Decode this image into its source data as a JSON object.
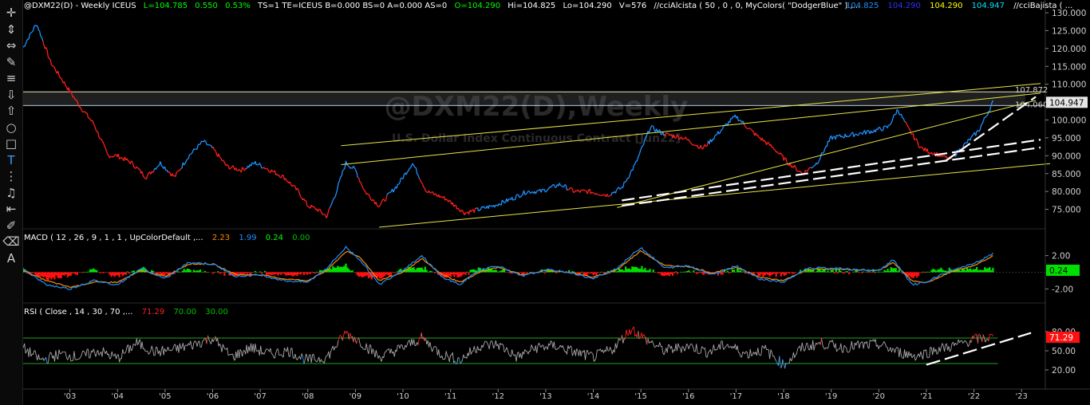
{
  "header": {
    "symbol": "@DXM22(D) - Weekly  ICEUS",
    "last": "L=104.785",
    "change": "0.550",
    "pct": "0.53%",
    "ts": "TS=1  TE=ICEUS  B=0.000  BS=0  A=0.000  AS=0",
    "open": "O=104.290",
    "high": "Hi=104.825",
    "low": "Lo=104.290",
    "vol": "V=576",
    "study": "//cciAlcista ( 50 , 0 , 0, MyColors( \"DodgerBlue\" ) ,...",
    "v1": "104.825",
    "v2": "104.290",
    "v3": "104.290",
    "v4": "104.947",
    "study2": "//cciBajista ( ..."
  },
  "watermark": {
    "title": "@DXM22(D),Weekly",
    "subtitle": "U.S. Dollar Index Continuous Contract [Jun22]"
  },
  "price_labels": {
    "upper": "107.872",
    "lower": "104.060",
    "last": "104.947"
  },
  "macd": {
    "label": "MACD ( 12 , 26 , 9 , 1 , 1 , UpColorDefault ,...",
    "v1": "2.23",
    "v2": "1.99",
    "v3": "0.24",
    "v4": "0.00",
    "last": "0.24"
  },
  "rsi": {
    "label": "RSI ( Close , 14 , 30 , 70 ,...",
    "v1": "71.29",
    "v2": "70.00",
    "v3": "30.00",
    "last": "71.29"
  },
  "toolbar": [
    {
      "name": "crosshair-tool",
      "icon": "crosshair-icon",
      "glyph": "✛"
    },
    {
      "name": "vertical-line-tool",
      "icon": "vertical-arrows-icon",
      "glyph": "⇕"
    },
    {
      "name": "horizontal-line-tool",
      "icon": "horizontal-arrows-icon",
      "glyph": "⇔"
    },
    {
      "name": "trendline-tool",
      "icon": "pencil-icon",
      "glyph": "✎"
    },
    {
      "name": "parallel-lines-tool",
      "icon": "lines-icon",
      "glyph": "≡"
    },
    {
      "name": "arrow-down-tool",
      "icon": "arrow-down-icon",
      "glyph": "⇩"
    },
    {
      "name": "arrow-up-tool",
      "icon": "arrow-up-icon",
      "glyph": "⇧"
    },
    {
      "name": "ellipse-tool",
      "icon": "circle-icon",
      "glyph": "○"
    },
    {
      "name": "rectangle-tool",
      "icon": "square-icon",
      "glyph": "□"
    },
    {
      "name": "text-tool",
      "icon": "text-icon",
      "glyph": "T"
    },
    {
      "name": "fibonacci-tool",
      "icon": "fib-icon",
      "glyph": "⋮"
    },
    {
      "name": "alert-tool",
      "icon": "bell-icon",
      "glyph": "♫"
    },
    {
      "name": "measure-tool",
      "icon": "measure-icon",
      "glyph": "⇤"
    },
    {
      "name": "paint-tool",
      "icon": "brush-icon",
      "glyph": "✐"
    },
    {
      "name": "eraser-tool",
      "icon": "eraser-icon",
      "glyph": "⌫"
    },
    {
      "name": "annotate-tool",
      "icon": "annotate-icon",
      "glyph": "A"
    }
  ],
  "chart_data": [
    {
      "type": "line",
      "ylim": [
        70,
        130
      ],
      "yticks": [
        "130.000",
        "125.000",
        "120.000",
        "115.000",
        "110.000",
        "105.000",
        "100.000",
        "95.000",
        "90.000",
        "85.000",
        "80.000",
        "75.000"
      ],
      "xticks": [
        "'03",
        "'04",
        "'05",
        "'06",
        "'07",
        "'08",
        "'09",
        "'10",
        "'11",
        "'12",
        "'13",
        "'14",
        "'15",
        "'16",
        "'17",
        "'18",
        "'19",
        "'20",
        "'21",
        "'22",
        "'23"
      ],
      "x": [
        2002.0,
        2002.3,
        2002.6,
        2002.9,
        2003.2,
        2003.5,
        2003.8,
        2004.0,
        2004.3,
        2004.6,
        2004.9,
        2005.2,
        2005.5,
        2005.8,
        2006.0,
        2006.3,
        2006.6,
        2006.9,
        2007.2,
        2007.5,
        2007.8,
        2008.0,
        2008.2,
        2008.4,
        2008.6,
        2008.8,
        2009.0,
        2009.2,
        2009.5,
        2009.9,
        2010.2,
        2010.5,
        2010.9,
        2011.3,
        2011.6,
        2011.9,
        2012.3,
        2012.6,
        2012.9,
        2013.3,
        2013.6,
        2013.9,
        2014.3,
        2014.6,
        2014.9,
        2015.2,
        2015.5,
        2015.9,
        2016.3,
        2016.6,
        2016.9,
        2017.0,
        2017.4,
        2017.8,
        2018.1,
        2018.4,
        2018.7,
        2019.0,
        2019.5,
        2019.9,
        2020.2,
        2020.4,
        2020.6,
        2020.9,
        2021.3,
        2021.5,
        2021.8,
        2022.1,
        2022.4
      ],
      "values": [
        120,
        127,
        116,
        110,
        104,
        99,
        90,
        90,
        88,
        84,
        88,
        84,
        90,
        94,
        92,
        87,
        86,
        88,
        86,
        84,
        80,
        76,
        75,
        73,
        80,
        88,
        86,
        80,
        76,
        82,
        88,
        80,
        78,
        74,
        75,
        76,
        78,
        80,
        80,
        82,
        80,
        80,
        79,
        81,
        88,
        98,
        96,
        95,
        92,
        96,
        100,
        101,
        96,
        92,
        88,
        85,
        88,
        95,
        96,
        97,
        98,
        103,
        98,
        92,
        90,
        89,
        93,
        97,
        104.947
      ],
      "colors": {
        "up": "#1e90ff",
        "down": "#ff1e1e",
        "channel": "#e6e64a",
        "support": "#ffffff",
        "resistance_zone": "#5a5a5a"
      },
      "levels": [
        107.872,
        104.06
      ]
    },
    {
      "type": "line",
      "title": "MACD",
      "ylim": [
        -3.5,
        3.5
      ],
      "yticks": [
        "2.00",
        "0.24",
        "-2.00"
      ],
      "series": [
        {
          "name": "MACD",
          "color": "#1e90ff"
        },
        {
          "name": "Signal",
          "color": "#ff8c00"
        }
      ],
      "x": [
        2002.0,
        2002.5,
        2003.0,
        2003.5,
        2004.0,
        2004.5,
        2005.0,
        2005.5,
        2006.0,
        2006.5,
        2007.0,
        2007.5,
        2008.0,
        2008.4,
        2008.8,
        2009.1,
        2009.5,
        2010.0,
        2010.4,
        2010.8,
        2011.2,
        2011.6,
        2012.0,
        2012.5,
        2013.0,
        2013.5,
        2014.0,
        2014.5,
        2015.0,
        2015.5,
        2016.0,
        2016.5,
        2017.0,
        2017.5,
        2018.0,
        2018.5,
        2019.0,
        2019.5,
        2020.0,
        2020.3,
        2020.7,
        2021.0,
        2021.5,
        2022.0,
        2022.4
      ],
      "values": [
        0.5,
        -1.5,
        -2.0,
        -1.0,
        -1.5,
        0.5,
        -0.8,
        1.2,
        1.0,
        -0.5,
        -0.3,
        -1.0,
        -1.2,
        0.5,
        3.0,
        1.5,
        -1.5,
        0.3,
        2.0,
        -0.5,
        -1.5,
        0.3,
        0.8,
        -0.5,
        0.3,
        0.0,
        -0.8,
        0.5,
        3.0,
        0.5,
        0.8,
        -0.3,
        0.8,
        -0.8,
        -1.2,
        0.5,
        0.5,
        0.3,
        0.2,
        1.5,
        -1.5,
        -1.2,
        0.2,
        1.0,
        2.23
      ],
      "signal": [
        0.3,
        -1.0,
        -1.8,
        -1.2,
        -1.2,
        0.2,
        -0.5,
        1.0,
        1.0,
        -0.3,
        -0.3,
        -0.8,
        -1.0,
        0.2,
        2.5,
        1.8,
        -1.0,
        0.0,
        1.6,
        -0.2,
        -1.2,
        0.0,
        0.6,
        -0.3,
        0.2,
        0.0,
        -0.6,
        0.3,
        2.6,
        0.8,
        0.7,
        -0.1,
        0.6,
        -0.6,
        -1.0,
        0.3,
        0.4,
        0.3,
        0.2,
        1.2,
        -1.0,
        -1.3,
        0.0,
        0.8,
        1.99
      ]
    },
    {
      "type": "line",
      "title": "RSI",
      "ylim": [
        0,
        100
      ],
      "yticks": [
        "80.00",
        "71.29",
        "50.00",
        "20.00"
      ],
      "levels": [
        70,
        30
      ],
      "x": [
        2002.0,
        2002.4,
        2002.8,
        2003.2,
        2003.6,
        2004.0,
        2004.4,
        2004.8,
        2005.2,
        2005.6,
        2006.0,
        2006.4,
        2006.8,
        2007.2,
        2007.6,
        2008.0,
        2008.4,
        2008.8,
        2009.1,
        2009.5,
        2010.0,
        2010.4,
        2010.8,
        2011.2,
        2011.6,
        2012.0,
        2012.4,
        2012.8,
        2013.2,
        2013.6,
        2014.0,
        2014.4,
        2014.8,
        2015.1,
        2015.5,
        2016.0,
        2016.4,
        2016.8,
        2017.2,
        2017.6,
        2018.0,
        2018.4,
        2018.8,
        2019.2,
        2019.6,
        2020.0,
        2020.4,
        2020.8,
        2021.2,
        2021.6,
        2022.0,
        2022.4
      ],
      "values": [
        55,
        35,
        45,
        40,
        50,
        38,
        62,
        48,
        52,
        60,
        70,
        40,
        55,
        45,
        50,
        35,
        40,
        78,
        65,
        40,
        55,
        70,
        45,
        35,
        58,
        60,
        40,
        55,
        58,
        48,
        40,
        52,
        85,
        68,
        50,
        58,
        48,
        60,
        45,
        52,
        28,
        55,
        62,
        55,
        58,
        60,
        48,
        42,
        52,
        58,
        68,
        71.29
      ]
    }
  ]
}
